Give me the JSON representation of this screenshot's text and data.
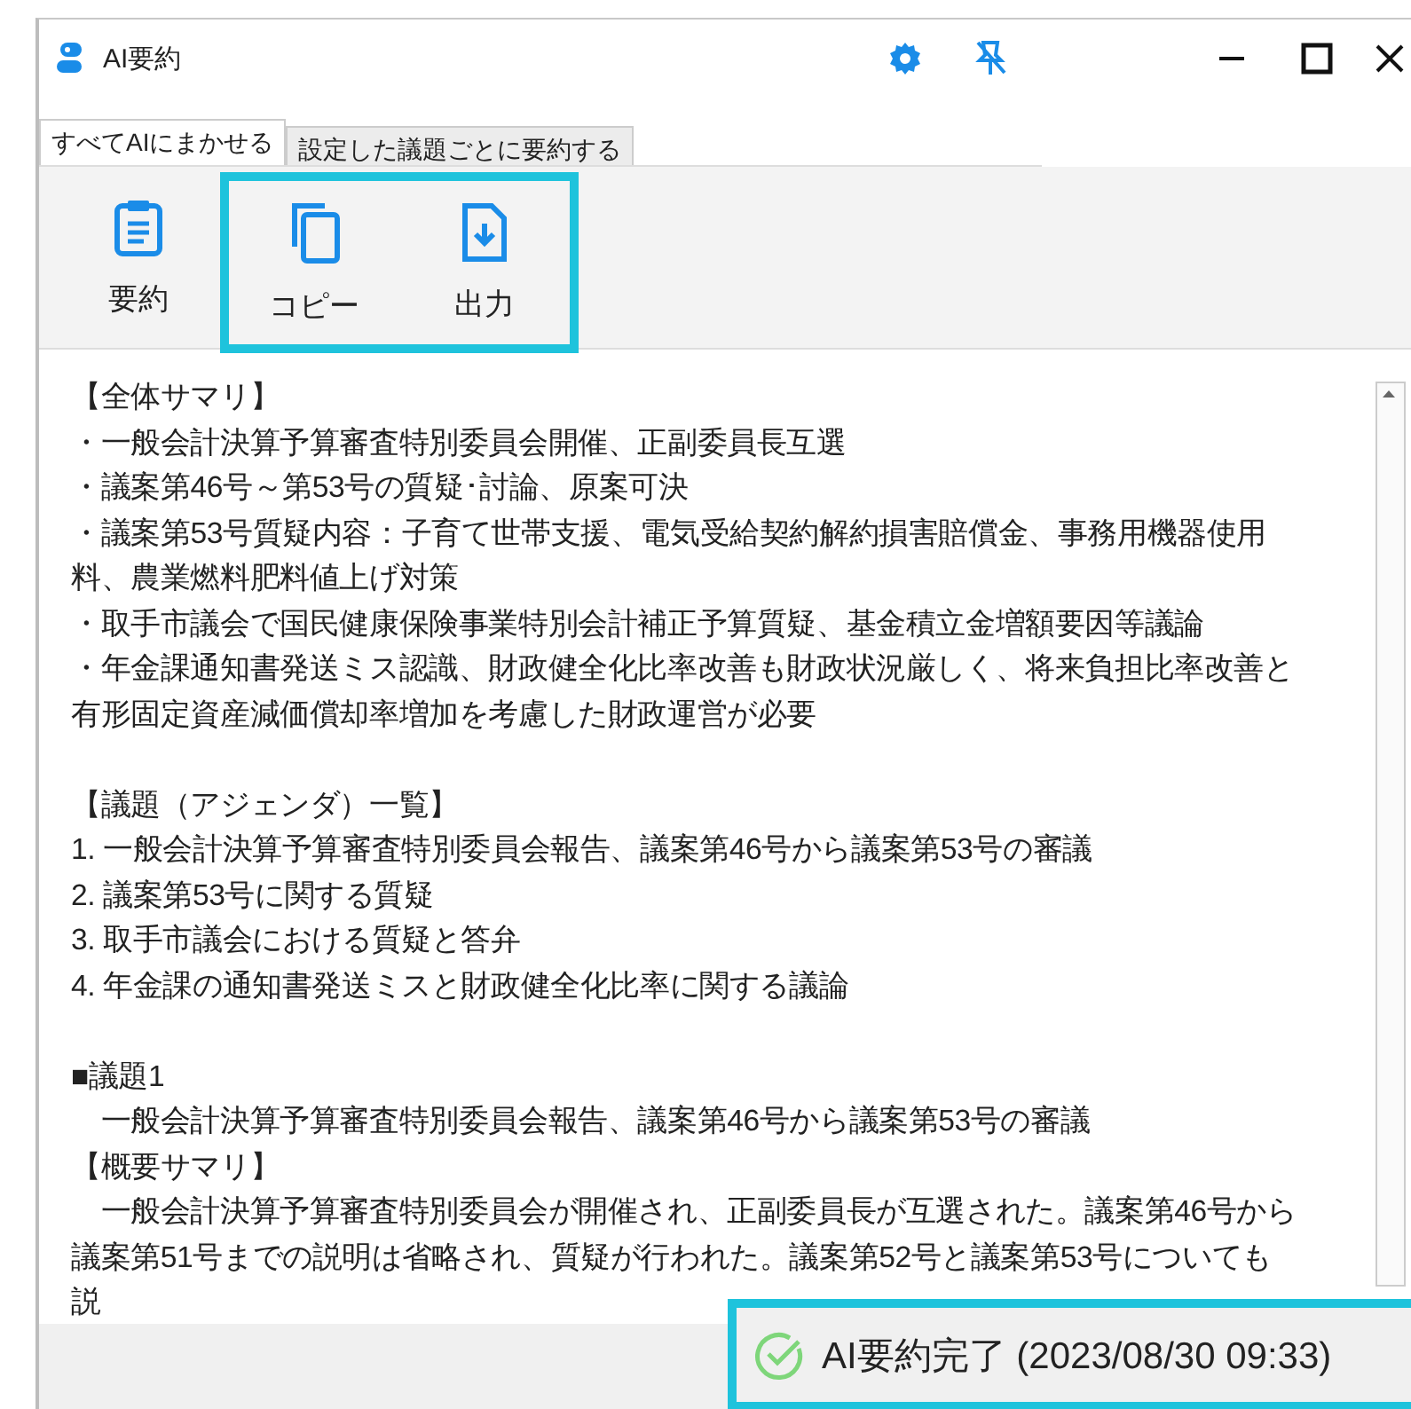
{
  "window": {
    "title": "AI要約"
  },
  "tabs": [
    {
      "label": "すべてAIにまかせる",
      "selected": true
    },
    {
      "label": "設定した議題ごとに要約する",
      "selected": false
    }
  ],
  "toolbar": [
    {
      "kind": "summarize",
      "label": "要約",
      "highlighted": false
    },
    {
      "kind": "copy",
      "label": "コピー",
      "highlighted": true
    },
    {
      "kind": "export",
      "label": "出力",
      "highlighted": true
    }
  ],
  "content": {
    "sections": [
      [
        "【全体サマリ】",
        "・一般会計決算予算審査特別委員会開催、正副委員長互選",
        "・議案第46号～第53号の質疑･討論、原案可決",
        "・議案第53号質疑内容：子育て世帯支援、電気受給契約解約損害賠償金、事務用機器使用料、農業燃料肥料値上げ対策",
        "・取手市議会で国民健康保険事業特別会計補正予算質疑、基金積立金増額要因等議論",
        "・年金課通知書発送ミス認識、財政健全化比率改善も財政状況厳しく、将来負担比率改善と有形固定資産減価償却率増加を考慮した財政運営が必要"
      ],
      [
        "【議題（アジェンダ）一覧】",
        "1. 一般会計決算予算審査特別委員会報告、議案第46号から議案第53号の審議",
        "2. 議案第53号に関する質疑",
        "3. 取手市議会における質疑と答弁",
        "4. 年金課の通知書発送ミスと財政健全化比率に関する議論"
      ],
      [
        "■議題1",
        "　一般会計決算予算審査特別委員会報告、議案第46号から議案第53号の審議",
        "【概要サマリ】",
        "　一般会計決算予算審査特別委員会が開催され、正副委員長が互選された。議案第46号から議案第51号までの説明は省略され、質疑が行われた。議案第52号と議案第53号についても説"
      ]
    ]
  },
  "status": {
    "text": "AI要約完了 (2023/08/30 09:33)",
    "done": true,
    "highlighted": true
  }
}
